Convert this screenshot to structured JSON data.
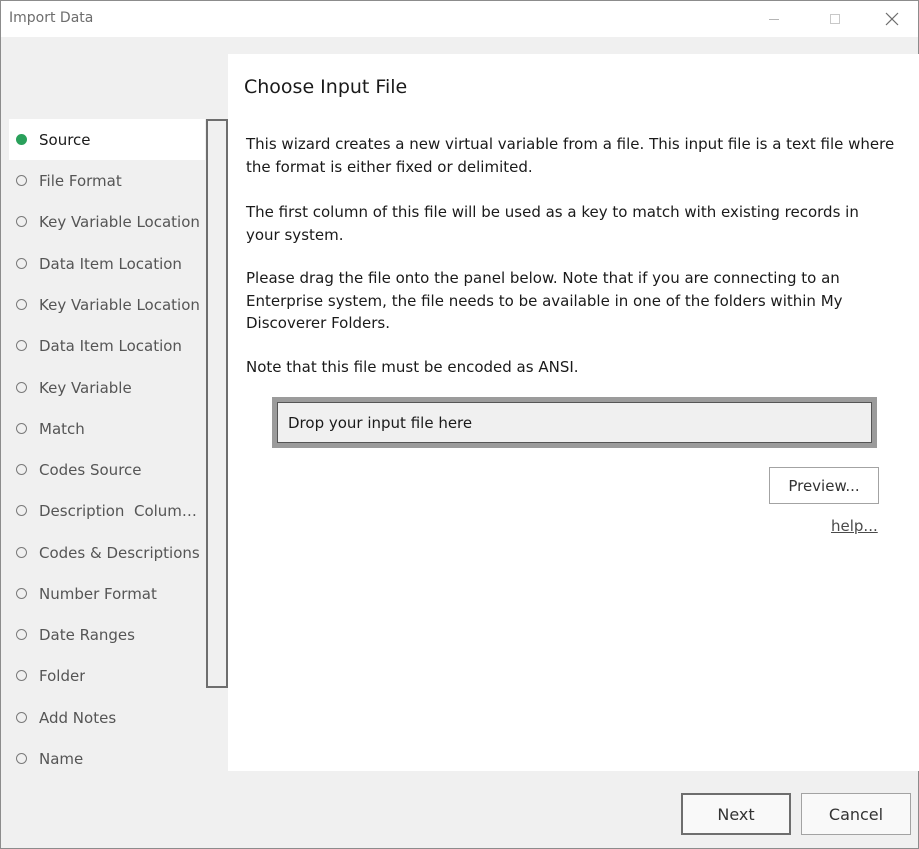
{
  "window": {
    "title": "Import Data",
    "controls": [
      "minimize-icon",
      "maximize-icon",
      "close-icon"
    ]
  },
  "sidebar": {
    "steps": [
      {
        "label": "Source",
        "active": true
      },
      {
        "label": "File Format",
        "active": false
      },
      {
        "label": "Key Variable Location",
        "active": false
      },
      {
        "label": "Data Item Location",
        "active": false
      },
      {
        "label": "Key Variable Location",
        "active": false
      },
      {
        "label": "Data Item Location",
        "active": false
      },
      {
        "label": "Key Variable",
        "active": false
      },
      {
        "label": "Match",
        "active": false
      },
      {
        "label": "Codes Source",
        "active": false
      },
      {
        "label": "Description  Column...",
        "active": false
      },
      {
        "label": "Codes & Descriptions",
        "active": false
      },
      {
        "label": "Number Format",
        "active": false
      },
      {
        "label": "Date Ranges",
        "active": false
      },
      {
        "label": "Folder",
        "active": false
      },
      {
        "label": "Add Notes",
        "active": false
      },
      {
        "label": "Name",
        "active": false
      }
    ],
    "active_color": "#2aa05b"
  },
  "main": {
    "heading": "Choose Input File",
    "paragraphs": [
      "This wizard creates a new virtual variable from a file. This input file is a text file where the format is either fixed or delimited.",
      "The first column of this file will be used as a key to match with existing records in your system.",
      "Please drag the file onto the panel below. Note that if you are connecting to an Enterprise system, the file needs to be available in one of the folders within My Discoverer Folders.",
      "Note that this file must be encoded as ANSI."
    ],
    "dropzone_text": "Drop your input file here",
    "preview_label": "Preview...",
    "help_label": "help..."
  },
  "footer": {
    "next_label": "Next",
    "cancel_label": "Cancel"
  }
}
